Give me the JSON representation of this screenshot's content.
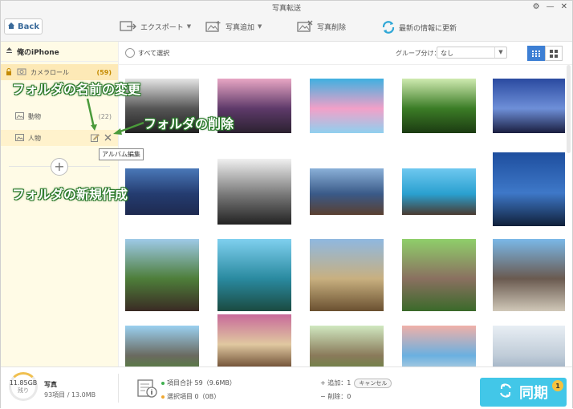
{
  "window": {
    "title": "写真転送",
    "controls": [
      "⚙",
      "—",
      "✕"
    ]
  },
  "header": {
    "back_label": "Back"
  },
  "toolbar": {
    "export_label": "エクスポート",
    "add_label": "写真追加",
    "delete_label": "写真削除",
    "refresh_label": "最新の情報に更新"
  },
  "sidebar": {
    "device_label": "俺のiPhone",
    "camera_roll": {
      "label": "カメラロール",
      "count": "(59)"
    },
    "albums": [
      {
        "label": "動物",
        "count": "(22)"
      },
      {
        "label": "人物",
        "count": ""
      }
    ],
    "tooltip": "アルバム編集"
  },
  "annotations": {
    "rename": "フォルダの名前の変更",
    "delete": "フォルダの削除",
    "create": "フォルダの新規作成"
  },
  "content": {
    "select_all": "すべて選択",
    "group_label": "グループ分け：",
    "group_value": "なし"
  },
  "colors": {
    "accent": "#42c7e8",
    "sidebar_bg": "#fffbe6",
    "highlight": "#fde9b6",
    "annotation": "#2c7a2c"
  },
  "photos": [
    {
      "name": "bw-stairs",
      "colors": [
        "#e5e5e5",
        "#555",
        "#222"
      ]
    },
    {
      "name": "castle-sunset",
      "colors": [
        "#e8a6c4",
        "#5e3a6a",
        "#2b2130"
      ]
    },
    {
      "name": "colorful-sky",
      "colors": [
        "#3fb0e0",
        "#f2a0c8",
        "#8fd0ef"
      ]
    },
    {
      "name": "green-tunnel",
      "colors": [
        "#cfeab0",
        "#3b7c26",
        "#1c3b12"
      ]
    },
    {
      "name": "city-night-wheel",
      "colors": [
        "#2a4aa0",
        "#6e8fd8",
        "#1a1e40"
      ]
    },
    {
      "name": "lake-mountains",
      "colors": [
        "#4a78b8",
        "#243c70",
        "#1e2a50"
      ]
    },
    {
      "name": "bw-street",
      "colors": [
        "#f0f0f0",
        "#777",
        "#222"
      ]
    },
    {
      "name": "lake-shore",
      "colors": [
        "#8ab0d8",
        "#3a5a88",
        "#5a4030"
      ]
    },
    {
      "name": "sea-cave",
      "colors": [
        "#6ec8f0",
        "#2aa0d0",
        "#4a3a30"
      ]
    },
    {
      "name": "coastal-castle",
      "colors": [
        "#1e4e9e",
        "#3e78c8",
        "#10203a"
      ]
    },
    {
      "name": "alpine-village",
      "colors": [
        "#9ecae8",
        "#4e7e3a",
        "#3a2a24"
      ]
    },
    {
      "name": "forest-lake",
      "colors": [
        "#7fd0ef",
        "#2a8aa0",
        "#1a4a40"
      ]
    },
    {
      "name": "colosseum-dancers",
      "colors": [
        "#8fb8e0",
        "#c8b080",
        "#6a5030"
      ]
    },
    {
      "name": "elephants-green",
      "colors": [
        "#8fcf6a",
        "#8a7060",
        "#3a6a2a"
      ]
    },
    {
      "name": "elephants-sky",
      "colors": [
        "#7ab8e8",
        "#6a5a50",
        "#d0c8b8"
      ]
    },
    {
      "name": "elephant-field",
      "colors": [
        "#9ad0f0",
        "#6a6a60",
        "#4a8a2a"
      ]
    },
    {
      "name": "cat-and-dog",
      "colors": [
        "#c86a9a",
        "#e0c8a0",
        "#6a4a30"
      ]
    },
    {
      "name": "hedgehog",
      "colors": [
        "#d0e8c0",
        "#8a7a5a",
        "#5a8a3a"
      ]
    },
    {
      "name": "sea-pink",
      "colors": [
        "#f0b0a8",
        "#6ab0e0",
        "#e0e0e0"
      ]
    },
    {
      "name": "arctic-fox",
      "colors": [
        "#e8eef4",
        "#c0ccd8",
        "#8aa0b8"
      ]
    }
  ],
  "footer": {
    "storage_free": "11.85GB",
    "storage_sub": "残り",
    "photos_title": "写真",
    "photos_detail": "93項目 / 13.0MB",
    "total_items": "項目合計 59（9.6MB）",
    "selected_items": "選択項目 0（0B）",
    "add_label": "+ 追加：1",
    "cancel_label": "キャンセル",
    "delete_label": "− 削除：0",
    "sync_label": "同期",
    "badge": "1"
  }
}
